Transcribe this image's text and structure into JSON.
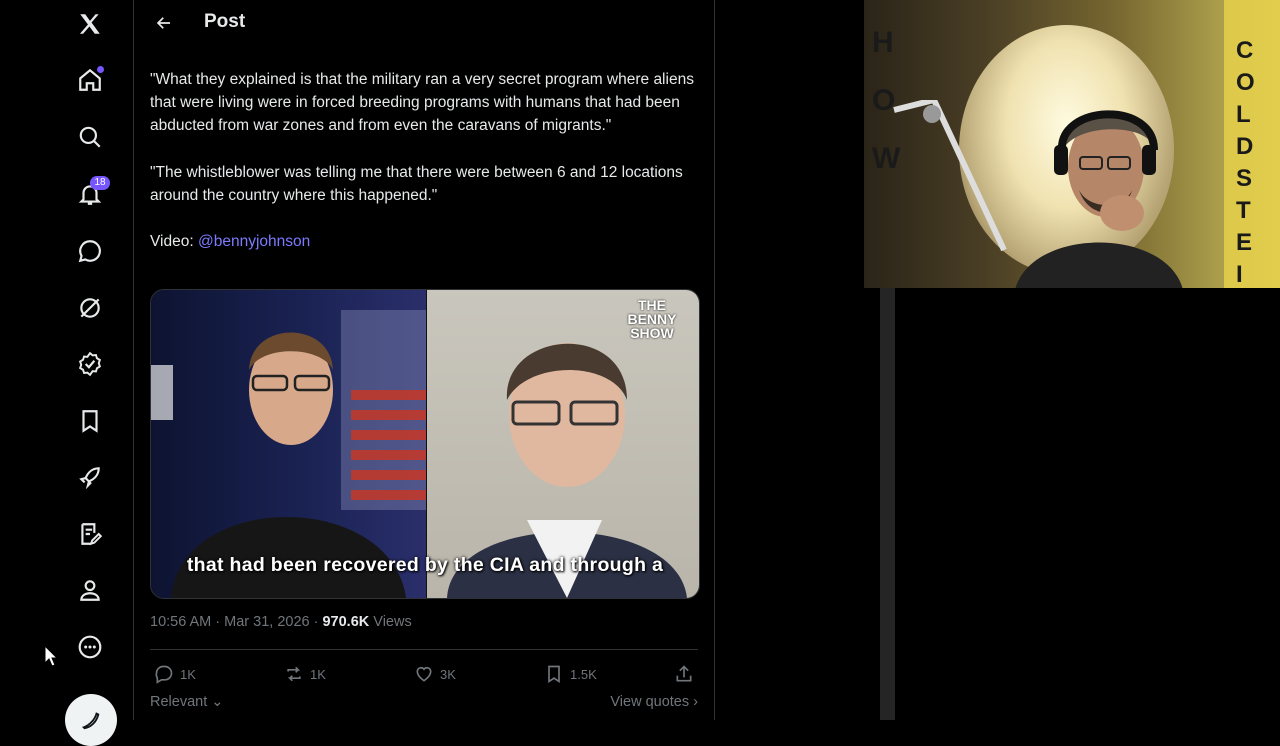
{
  "nav": {
    "notifications_badge": "18"
  },
  "header": {
    "title": "Post"
  },
  "post": {
    "paragraph1": "\"What they explained is that the military ran a very secret program where aliens that were living were in forced breeding programs with humans that had been abducted from war zones and from even the caravans of migrants.\"",
    "paragraph2": "\"The whistleblower was telling me that there were between 6 and 12 locations around the country where this happened.\"",
    "video_label": "Video: ",
    "video_mention": "@bennyjohnson",
    "video_caption": "that had been recovered by the CIA and through a",
    "video_logo": "THE BENNY SHOW",
    "timestamp": "10:56 AM · Mar 31, 2026 · ",
    "views_count": "970.6K",
    "views_label": " Views"
  },
  "actions": {
    "replies": "1K",
    "reposts": "1K",
    "likes": "3K",
    "bookmarks": "1.5K"
  },
  "footer": {
    "sort_label": "Relevant",
    "view_quotes": "View quotes"
  },
  "webcam": {
    "sign_left": "HOW",
    "sign_right": "GOLDSTEIN"
  },
  "colors": {
    "accent": "#7856ff",
    "link": "#7c7bff",
    "muted": "#71767b",
    "text": "#e7e9ea",
    "border": "#2f3336"
  }
}
